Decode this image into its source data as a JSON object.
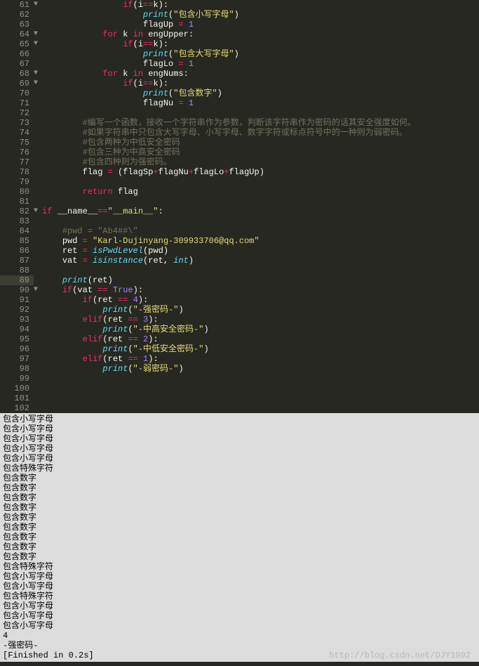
{
  "editor": {
    "highlighted_line": 89,
    "lines": [
      {
        "n": 61,
        "fold": "▼",
        "indent": 16,
        "tok": [
          [
            "kw",
            "if"
          ],
          [
            "plain",
            "(i"
          ],
          [
            "op",
            "=="
          ],
          [
            "plain",
            "k):"
          ]
        ]
      },
      {
        "n": 62,
        "fold": "",
        "indent": 20,
        "tok": [
          [
            "fn",
            "print"
          ],
          [
            "plain",
            "("
          ],
          [
            "str",
            "\"包含小写字母\""
          ],
          [
            "plain",
            ")"
          ]
        ]
      },
      {
        "n": 63,
        "fold": "",
        "indent": 20,
        "tok": [
          [
            "plain",
            "flagUp "
          ],
          [
            "op",
            "="
          ],
          [
            "plain",
            " "
          ],
          [
            "num",
            "1"
          ]
        ]
      },
      {
        "n": 64,
        "fold": "▼",
        "indent": 12,
        "tok": [
          [
            "kw",
            "for"
          ],
          [
            "plain",
            " k "
          ],
          [
            "kw",
            "in"
          ],
          [
            "plain",
            " engUpper:"
          ]
        ]
      },
      {
        "n": 65,
        "fold": "▼",
        "indent": 16,
        "tok": [
          [
            "kw",
            "if"
          ],
          [
            "plain",
            "(i"
          ],
          [
            "op",
            "=="
          ],
          [
            "plain",
            "k):"
          ]
        ]
      },
      {
        "n": 66,
        "fold": "",
        "indent": 20,
        "tok": [
          [
            "fn",
            "print"
          ],
          [
            "plain",
            "("
          ],
          [
            "str",
            "\"包含大写字母\""
          ],
          [
            "plain",
            ")"
          ]
        ]
      },
      {
        "n": 67,
        "fold": "",
        "indent": 20,
        "tok": [
          [
            "plain",
            "flagLo "
          ],
          [
            "op",
            "="
          ],
          [
            "plain",
            " "
          ],
          [
            "num",
            "1"
          ]
        ]
      },
      {
        "n": 68,
        "fold": "▼",
        "indent": 12,
        "tok": [
          [
            "kw",
            "for"
          ],
          [
            "plain",
            " k "
          ],
          [
            "kw",
            "in"
          ],
          [
            "plain",
            " engNums:"
          ]
        ]
      },
      {
        "n": 69,
        "fold": "▼",
        "indent": 16,
        "tok": [
          [
            "kw",
            "if"
          ],
          [
            "plain",
            "(i"
          ],
          [
            "op",
            "=="
          ],
          [
            "plain",
            "k):"
          ]
        ]
      },
      {
        "n": 70,
        "fold": "",
        "indent": 20,
        "tok": [
          [
            "fn",
            "print"
          ],
          [
            "plain",
            "("
          ],
          [
            "str",
            "\"包含数字\""
          ],
          [
            "plain",
            ")"
          ]
        ]
      },
      {
        "n": 71,
        "fold": "",
        "indent": 20,
        "tok": [
          [
            "plain",
            "flagNu "
          ],
          [
            "op",
            "="
          ],
          [
            "plain",
            " "
          ],
          [
            "num",
            "1"
          ]
        ]
      },
      {
        "n": 72,
        "fold": "",
        "indent": 0,
        "tok": []
      },
      {
        "n": 73,
        "fold": "",
        "indent": 8,
        "tok": [
          [
            "cmt",
            "#编写一个函数，接收一个字符串作为参数，判断该字符串作为密码的话其安全强度如何。"
          ]
        ]
      },
      {
        "n": 74,
        "fold": "",
        "indent": 8,
        "tok": [
          [
            "cmt",
            "#如果字符串中只包含大写字母、小写字母、数字字符或标点符号中的一种则为弱密码。"
          ]
        ]
      },
      {
        "n": 75,
        "fold": "",
        "indent": 8,
        "tok": [
          [
            "cmt",
            "#包含两种为中低安全密码"
          ]
        ]
      },
      {
        "n": 76,
        "fold": "",
        "indent": 8,
        "tok": [
          [
            "cmt",
            "#包含三种为中高安全密码"
          ]
        ]
      },
      {
        "n": 77,
        "fold": "",
        "indent": 8,
        "tok": [
          [
            "cmt",
            "#包含四种则为强密码。"
          ]
        ]
      },
      {
        "n": 78,
        "fold": "",
        "indent": 8,
        "tok": [
          [
            "plain",
            "flag "
          ],
          [
            "op",
            "="
          ],
          [
            "plain",
            " (flagSp"
          ],
          [
            "op",
            "+"
          ],
          [
            "plain",
            "flagNu"
          ],
          [
            "op",
            "+"
          ],
          [
            "plain",
            "flagLo"
          ],
          [
            "op",
            "+"
          ],
          [
            "plain",
            "flagUp)"
          ]
        ]
      },
      {
        "n": 79,
        "fold": "",
        "indent": 0,
        "tok": []
      },
      {
        "n": 80,
        "fold": "",
        "indent": 8,
        "tok": [
          [
            "kw",
            "return"
          ],
          [
            "plain",
            " flag"
          ]
        ]
      },
      {
        "n": 81,
        "fold": "",
        "indent": 0,
        "tok": []
      },
      {
        "n": 82,
        "fold": "▼",
        "indent": 0,
        "tok": [
          [
            "kw",
            "if"
          ],
          [
            "plain",
            " __name__"
          ],
          [
            "op",
            "=="
          ],
          [
            "str",
            "\"__main__\""
          ],
          [
            "plain",
            ":"
          ]
        ]
      },
      {
        "n": 83,
        "fold": "",
        "indent": 0,
        "tok": []
      },
      {
        "n": 84,
        "fold": "",
        "indent": 4,
        "tok": [
          [
            "cmt",
            "#pwd = \"Ab4##\\\""
          ]
        ]
      },
      {
        "n": 85,
        "fold": "",
        "indent": 4,
        "tok": [
          [
            "plain",
            "pwd "
          ],
          [
            "op",
            "="
          ],
          [
            "plain",
            " "
          ],
          [
            "str",
            "\"Karl-Dujinyang-309933706@qq.com\""
          ]
        ]
      },
      {
        "n": 86,
        "fold": "",
        "indent": 4,
        "tok": [
          [
            "plain",
            "ret "
          ],
          [
            "op",
            "="
          ],
          [
            "plain",
            " "
          ],
          [
            "fn",
            "isPwdLevel"
          ],
          [
            "plain",
            "(pwd)"
          ]
        ]
      },
      {
        "n": 87,
        "fold": "",
        "indent": 4,
        "tok": [
          [
            "plain",
            "vat "
          ],
          [
            "op",
            "="
          ],
          [
            "plain",
            " "
          ],
          [
            "fn",
            "isinstance"
          ],
          [
            "plain",
            "(ret, "
          ],
          [
            "builtin",
            "int"
          ],
          [
            "plain",
            ")"
          ]
        ]
      },
      {
        "n": 88,
        "fold": "",
        "indent": 0,
        "tok": []
      },
      {
        "n": 89,
        "fold": "",
        "indent": 4,
        "tok": [
          [
            "fn",
            "print"
          ],
          [
            "plain",
            "(ret)"
          ]
        ]
      },
      {
        "n": 90,
        "fold": "▼",
        "indent": 4,
        "tok": [
          [
            "kw",
            "if"
          ],
          [
            "plain",
            "(vat "
          ],
          [
            "op",
            "=="
          ],
          [
            "plain",
            " "
          ],
          [
            "num",
            "True"
          ],
          [
            "plain",
            "):"
          ]
        ]
      },
      {
        "n": 91,
        "fold": "",
        "indent": 8,
        "tok": [
          [
            "kw",
            "if"
          ],
          [
            "plain",
            "(ret "
          ],
          [
            "op",
            "=="
          ],
          [
            "plain",
            " "
          ],
          [
            "num",
            "4"
          ],
          [
            "plain",
            "):"
          ]
        ]
      },
      {
        "n": 92,
        "fold": "",
        "indent": 12,
        "tok": [
          [
            "fn",
            "print"
          ],
          [
            "plain",
            "("
          ],
          [
            "str",
            "\"-强密码-\""
          ],
          [
            "plain",
            ")"
          ]
        ]
      },
      {
        "n": 93,
        "fold": "",
        "indent": 8,
        "tok": [
          [
            "kw",
            "elif"
          ],
          [
            "plain",
            "(ret "
          ],
          [
            "op",
            "=="
          ],
          [
            "plain",
            " "
          ],
          [
            "num",
            "3"
          ],
          [
            "plain",
            "):"
          ]
        ]
      },
      {
        "n": 94,
        "fold": "",
        "indent": 12,
        "tok": [
          [
            "fn",
            "print"
          ],
          [
            "plain",
            "("
          ],
          [
            "str",
            "\"-中高安全密码-\""
          ],
          [
            "plain",
            ")"
          ]
        ]
      },
      {
        "n": 95,
        "fold": "",
        "indent": 8,
        "tok": [
          [
            "kw",
            "elif"
          ],
          [
            "plain",
            "(ret "
          ],
          [
            "op",
            "=="
          ],
          [
            "plain",
            " "
          ],
          [
            "num",
            "2"
          ],
          [
            "plain",
            "):"
          ]
        ]
      },
      {
        "n": 96,
        "fold": "",
        "indent": 12,
        "tok": [
          [
            "fn",
            "print"
          ],
          [
            "plain",
            "("
          ],
          [
            "str",
            "\"-中低安全密码-\""
          ],
          [
            "plain",
            ")"
          ]
        ]
      },
      {
        "n": 97,
        "fold": "",
        "indent": 8,
        "tok": [
          [
            "kw",
            "elif"
          ],
          [
            "plain",
            "(ret "
          ],
          [
            "op",
            "=="
          ],
          [
            "plain",
            " "
          ],
          [
            "num",
            "1"
          ],
          [
            "plain",
            "):"
          ]
        ]
      },
      {
        "n": 98,
        "fold": "",
        "indent": 12,
        "tok": [
          [
            "fn",
            "print"
          ],
          [
            "plain",
            "("
          ],
          [
            "str",
            "\"-弱密码-\""
          ],
          [
            "plain",
            ")"
          ]
        ]
      },
      {
        "n": 99,
        "fold": "",
        "indent": 0,
        "tok": []
      },
      {
        "n": 100,
        "fold": "",
        "indent": 0,
        "tok": []
      },
      {
        "n": 101,
        "fold": "",
        "indent": 0,
        "tok": []
      },
      {
        "n": 102,
        "fold": "",
        "indent": 0,
        "tok": []
      }
    ]
  },
  "console": {
    "lines": [
      "包含小写字母",
      "包含小写字母",
      "包含小写字母",
      "包含小写字母",
      "包含小写字母",
      "包含特殊字符",
      "包含数字",
      "包含数字",
      "包含数字",
      "包含数字",
      "包含数字",
      "包含数字",
      "包含数字",
      "包含数字",
      "包含数字",
      "包含特殊字符",
      "包含小写字母",
      "包含小写字母",
      "包含特殊字符",
      "包含小写字母",
      "包含小写字母",
      "包含小写字母",
      "4",
      "-强密码-",
      "[Finished in 0.2s]"
    ],
    "watermark": "http://blog.csdn.net/DJY1992"
  }
}
